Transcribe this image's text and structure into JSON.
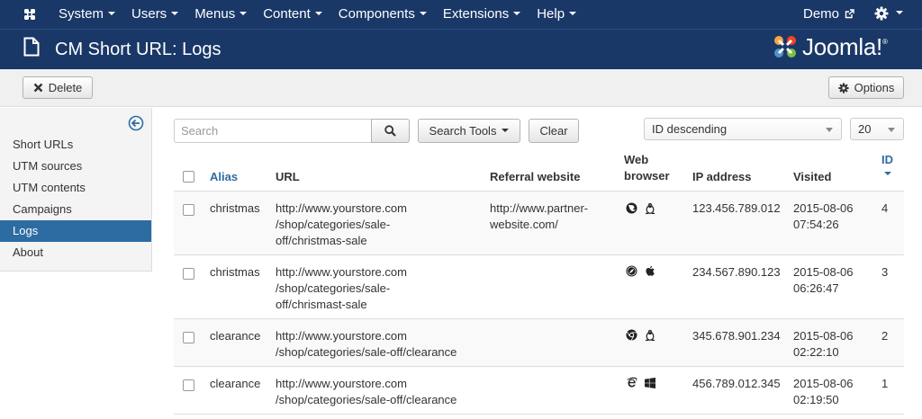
{
  "navbar": {
    "menu": [
      {
        "name": "menu-system",
        "label": "System"
      },
      {
        "name": "menu-users",
        "label": "Users"
      },
      {
        "name": "menu-menus",
        "label": "Menus"
      },
      {
        "name": "menu-content",
        "label": "Content"
      },
      {
        "name": "menu-components",
        "label": "Components"
      },
      {
        "name": "menu-extensions",
        "label": "Extensions"
      },
      {
        "name": "menu-help",
        "label": "Help"
      }
    ],
    "site_link": "Demo"
  },
  "header": {
    "title": "CM Short URL: Logs",
    "brand": "Joomla!"
  },
  "toolbar": {
    "delete_label": "Delete",
    "options_label": "Options"
  },
  "sidebar": {
    "items": [
      {
        "label": "Short URLs",
        "active": false
      },
      {
        "label": "UTM sources",
        "active": false
      },
      {
        "label": "UTM contents",
        "active": false
      },
      {
        "label": "Campaigns",
        "active": false
      },
      {
        "label": "Logs",
        "active": true
      },
      {
        "label": "About",
        "active": false
      }
    ]
  },
  "filters": {
    "search_placeholder": "Search",
    "search_tools_label": "Search Tools",
    "clear_label": "Clear",
    "ordering": "ID descending",
    "limit": "20"
  },
  "table": {
    "columns": {
      "alias": "Alias",
      "url": "URL",
      "referral": "Referral website",
      "browser_line1": "Web",
      "browser_line2": "browser",
      "ip": "IP address",
      "visited": "Visited",
      "id": "ID"
    },
    "rows": [
      {
        "alias": "christmas",
        "url": [
          "http://www.yourstore.com",
          "/shop/categories/sale-",
          "off/christmas-sale"
        ],
        "referral": [
          "http://www.partner-",
          "website.com/"
        ],
        "browser_icon": "firefox-icon",
        "os_icon": "linux-icon",
        "ip": "123.456.789.012",
        "date": "2015-08-06",
        "time": "07:54:26",
        "id": "4"
      },
      {
        "alias": "christmas",
        "url": [
          "http://www.yourstore.com",
          "/shop/categories/sale-",
          "off/chrismast-sale"
        ],
        "referral": [],
        "browser_icon": "safari-icon",
        "os_icon": "apple-icon",
        "ip": "234.567.890.123",
        "date": "2015-08-06",
        "time": "06:26:47",
        "id": "3"
      },
      {
        "alias": "clearance",
        "url": [
          "http://www.yourstore.com",
          "/shop/categories/sale-off/clearance"
        ],
        "referral": [],
        "browser_icon": "chrome-icon",
        "os_icon": "linux-icon",
        "ip": "345.678.901.234",
        "date": "2015-08-06",
        "time": "02:22:10",
        "id": "2"
      },
      {
        "alias": "clearance",
        "url": [
          "http://www.yourstore.com",
          "/shop/categories/sale-off/clearance"
        ],
        "referral": [],
        "browser_icon": "ie-icon",
        "os_icon": "windows-icon",
        "ip": "456.789.012.345",
        "date": "2015-08-06",
        "time": "02:19:50",
        "id": "1"
      }
    ]
  },
  "colors": {
    "navbar": "#1a3867",
    "link": "#2d6ca2",
    "active_sidebar": "#2d6ca2"
  }
}
